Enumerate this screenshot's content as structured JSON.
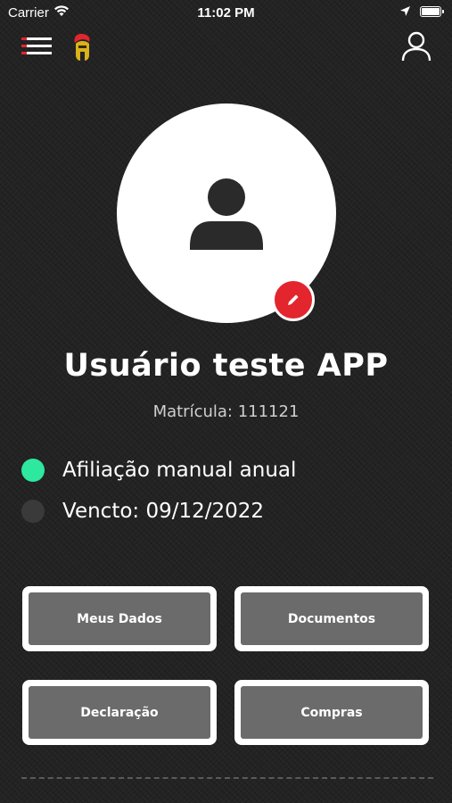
{
  "status_bar": {
    "carrier": "Carrier",
    "time": "11:02 PM",
    "icons": [
      "wifi-icon",
      "location-arrow-icon",
      "battery-icon"
    ]
  },
  "nav": {
    "menu_icon": "hamburger-menu-icon",
    "logo_icon": "spartan-helmet-logo",
    "profile_icon": "user-profile-icon"
  },
  "profile": {
    "avatar_icon": "user-silhouette-icon",
    "edit_icon": "pencil-icon",
    "name": "Usuário teste APP",
    "matricula": "Matrícula: 111121"
  },
  "membership": {
    "plan": "Afiliação manual anual",
    "plan_status_color": "#2ee8a0",
    "expiry": "Vencto: 09/12/2022",
    "expiry_status_color": "#3a3a3a"
  },
  "actions": {
    "meus_dados": "Meus Dados",
    "documentos": "Documentos",
    "declaracao": "Declaração",
    "compras": "Compras"
  },
  "colors": {
    "accent": "#e3252d",
    "button_fill": "#6b6b6b",
    "background": "#232323"
  }
}
